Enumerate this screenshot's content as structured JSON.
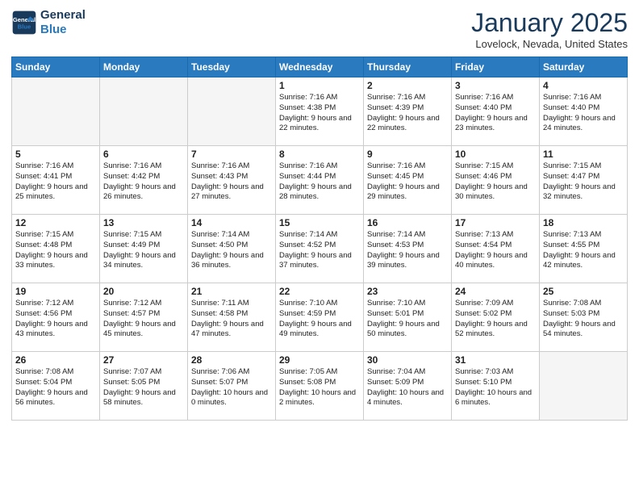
{
  "logo": {
    "line1": "General",
    "line2": "Blue"
  },
  "title": "January 2025",
  "location": "Lovelock, Nevada, United States",
  "days_header": [
    "Sunday",
    "Monday",
    "Tuesday",
    "Wednesday",
    "Thursday",
    "Friday",
    "Saturday"
  ],
  "weeks": [
    [
      {
        "day": "",
        "info": ""
      },
      {
        "day": "",
        "info": ""
      },
      {
        "day": "",
        "info": ""
      },
      {
        "day": "1",
        "info": "Sunrise: 7:16 AM\nSunset: 4:38 PM\nDaylight: 9 hours and 22 minutes."
      },
      {
        "day": "2",
        "info": "Sunrise: 7:16 AM\nSunset: 4:39 PM\nDaylight: 9 hours and 22 minutes."
      },
      {
        "day": "3",
        "info": "Sunrise: 7:16 AM\nSunset: 4:40 PM\nDaylight: 9 hours and 23 minutes."
      },
      {
        "day": "4",
        "info": "Sunrise: 7:16 AM\nSunset: 4:40 PM\nDaylight: 9 hours and 24 minutes."
      }
    ],
    [
      {
        "day": "5",
        "info": "Sunrise: 7:16 AM\nSunset: 4:41 PM\nDaylight: 9 hours and 25 minutes."
      },
      {
        "day": "6",
        "info": "Sunrise: 7:16 AM\nSunset: 4:42 PM\nDaylight: 9 hours and 26 minutes."
      },
      {
        "day": "7",
        "info": "Sunrise: 7:16 AM\nSunset: 4:43 PM\nDaylight: 9 hours and 27 minutes."
      },
      {
        "day": "8",
        "info": "Sunrise: 7:16 AM\nSunset: 4:44 PM\nDaylight: 9 hours and 28 minutes."
      },
      {
        "day": "9",
        "info": "Sunrise: 7:16 AM\nSunset: 4:45 PM\nDaylight: 9 hours and 29 minutes."
      },
      {
        "day": "10",
        "info": "Sunrise: 7:15 AM\nSunset: 4:46 PM\nDaylight: 9 hours and 30 minutes."
      },
      {
        "day": "11",
        "info": "Sunrise: 7:15 AM\nSunset: 4:47 PM\nDaylight: 9 hours and 32 minutes."
      }
    ],
    [
      {
        "day": "12",
        "info": "Sunrise: 7:15 AM\nSunset: 4:48 PM\nDaylight: 9 hours and 33 minutes."
      },
      {
        "day": "13",
        "info": "Sunrise: 7:15 AM\nSunset: 4:49 PM\nDaylight: 9 hours and 34 minutes."
      },
      {
        "day": "14",
        "info": "Sunrise: 7:14 AM\nSunset: 4:50 PM\nDaylight: 9 hours and 36 minutes."
      },
      {
        "day": "15",
        "info": "Sunrise: 7:14 AM\nSunset: 4:52 PM\nDaylight: 9 hours and 37 minutes."
      },
      {
        "day": "16",
        "info": "Sunrise: 7:14 AM\nSunset: 4:53 PM\nDaylight: 9 hours and 39 minutes."
      },
      {
        "day": "17",
        "info": "Sunrise: 7:13 AM\nSunset: 4:54 PM\nDaylight: 9 hours and 40 minutes."
      },
      {
        "day": "18",
        "info": "Sunrise: 7:13 AM\nSunset: 4:55 PM\nDaylight: 9 hours and 42 minutes."
      }
    ],
    [
      {
        "day": "19",
        "info": "Sunrise: 7:12 AM\nSunset: 4:56 PM\nDaylight: 9 hours and 43 minutes."
      },
      {
        "day": "20",
        "info": "Sunrise: 7:12 AM\nSunset: 4:57 PM\nDaylight: 9 hours and 45 minutes."
      },
      {
        "day": "21",
        "info": "Sunrise: 7:11 AM\nSunset: 4:58 PM\nDaylight: 9 hours and 47 minutes."
      },
      {
        "day": "22",
        "info": "Sunrise: 7:10 AM\nSunset: 4:59 PM\nDaylight: 9 hours and 49 minutes."
      },
      {
        "day": "23",
        "info": "Sunrise: 7:10 AM\nSunset: 5:01 PM\nDaylight: 9 hours and 50 minutes."
      },
      {
        "day": "24",
        "info": "Sunrise: 7:09 AM\nSunset: 5:02 PM\nDaylight: 9 hours and 52 minutes."
      },
      {
        "day": "25",
        "info": "Sunrise: 7:08 AM\nSunset: 5:03 PM\nDaylight: 9 hours and 54 minutes."
      }
    ],
    [
      {
        "day": "26",
        "info": "Sunrise: 7:08 AM\nSunset: 5:04 PM\nDaylight: 9 hours and 56 minutes."
      },
      {
        "day": "27",
        "info": "Sunrise: 7:07 AM\nSunset: 5:05 PM\nDaylight: 9 hours and 58 minutes."
      },
      {
        "day": "28",
        "info": "Sunrise: 7:06 AM\nSunset: 5:07 PM\nDaylight: 10 hours and 0 minutes."
      },
      {
        "day": "29",
        "info": "Sunrise: 7:05 AM\nSunset: 5:08 PM\nDaylight: 10 hours and 2 minutes."
      },
      {
        "day": "30",
        "info": "Sunrise: 7:04 AM\nSunset: 5:09 PM\nDaylight: 10 hours and 4 minutes."
      },
      {
        "day": "31",
        "info": "Sunrise: 7:03 AM\nSunset: 5:10 PM\nDaylight: 10 hours and 6 minutes."
      },
      {
        "day": "",
        "info": ""
      }
    ]
  ]
}
